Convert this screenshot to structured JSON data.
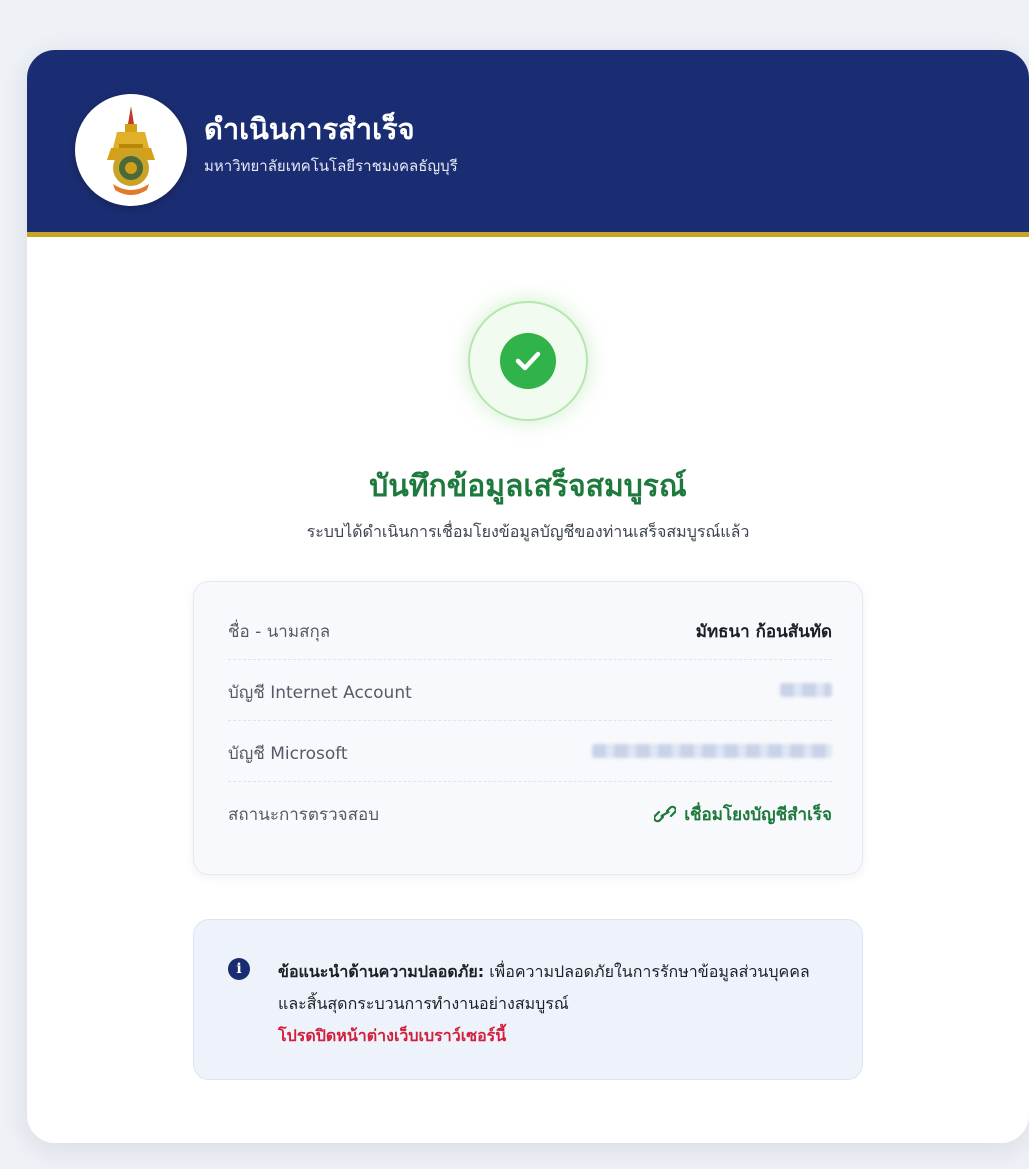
{
  "header": {
    "title": "ดำเนินการสำเร็จ",
    "subtitle": "มหาวิทยาลัยเทคโนโลยีราชมงคลธัญบุรี",
    "logo_icon": "university-emblem-icon"
  },
  "status": {
    "icon": "check-circle-icon",
    "title": "บันทึกข้อมูลเสร็จสมบูรณ์",
    "description": "ระบบได้ดำเนินการเชื่อมโยงข้อมูลบัญชีของท่านเสร็จสมบูรณ์แล้ว"
  },
  "details": {
    "rows": [
      {
        "label": "ชื่อ - นามสกุล",
        "value": "มัทธนา ก้อนสันทัด"
      },
      {
        "label": "บัญชี Internet Account",
        "value": ""
      },
      {
        "label": "บัญชี Microsoft",
        "value": ""
      },
      {
        "label": "สถานะการตรวจสอบ",
        "value": "เชื่อมโยงบัญชีสำเร็จ",
        "icon": "link-icon"
      }
    ]
  },
  "tip": {
    "icon": "info-icon",
    "lead": "ข้อแนะนำด้านความปลอดภัย:",
    "body": " เพื่อความปลอดภัยในการรักษาข้อมูลส่วนบุคคลและสิ้นสุดกระบวนการทำงานอย่างสมบูรณ์",
    "warning": "โปรดปิดหน้าต่างเว็บเบราว์เซอร์นี้"
  },
  "colors": {
    "header_bg": "#1b2d72",
    "header_accent": "#c9a227",
    "success": "#1e7a3c",
    "warning": "#d21f3c"
  }
}
